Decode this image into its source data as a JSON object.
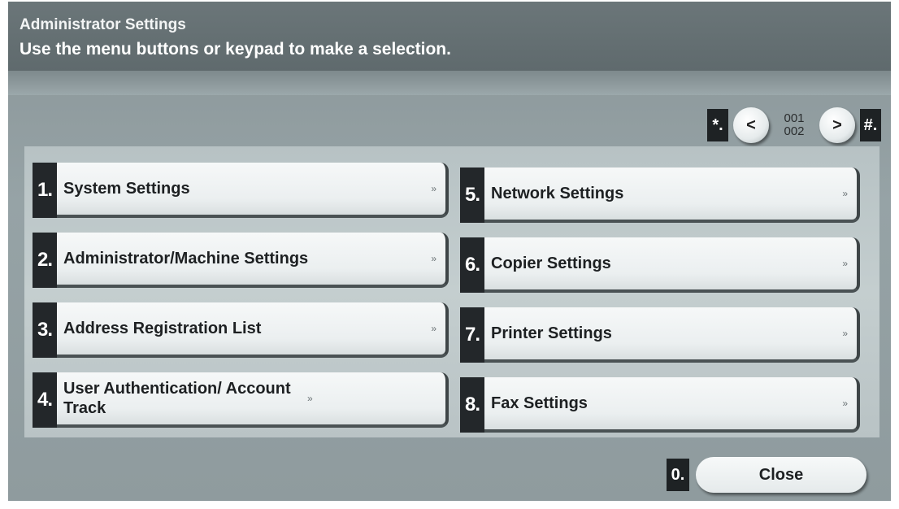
{
  "header": {
    "title": "Administrator Settings",
    "instruction": "Use the menu buttons or keypad to make a selection."
  },
  "pager": {
    "prev_key": "*.",
    "prev_icon": "chevron-left",
    "prev_symbol": "<",
    "current_page": "001",
    "total_pages": "002",
    "next_icon": "chevron-right",
    "next_symbol": ">",
    "next_key": "#."
  },
  "menu": {
    "left": [
      {
        "num": "1.",
        "label": "System Settings"
      },
      {
        "num": "2.",
        "label": "Administrator/Machine Settings"
      },
      {
        "num": "3.",
        "label": "Address Registration List"
      },
      {
        "num": "4.",
        "label": "User Authentication/ Account Track"
      }
    ],
    "right": [
      {
        "num": "5.",
        "label": "Network Settings"
      },
      {
        "num": "6.",
        "label": "Copier Settings"
      },
      {
        "num": "7.",
        "label": "Printer Settings"
      },
      {
        "num": "8.",
        "label": "Fax Settings"
      }
    ],
    "arrow_glyph": "»",
    "arrow_icon": "double-chevron-right"
  },
  "footer": {
    "close_num": "0.",
    "close_label": "Close"
  }
}
